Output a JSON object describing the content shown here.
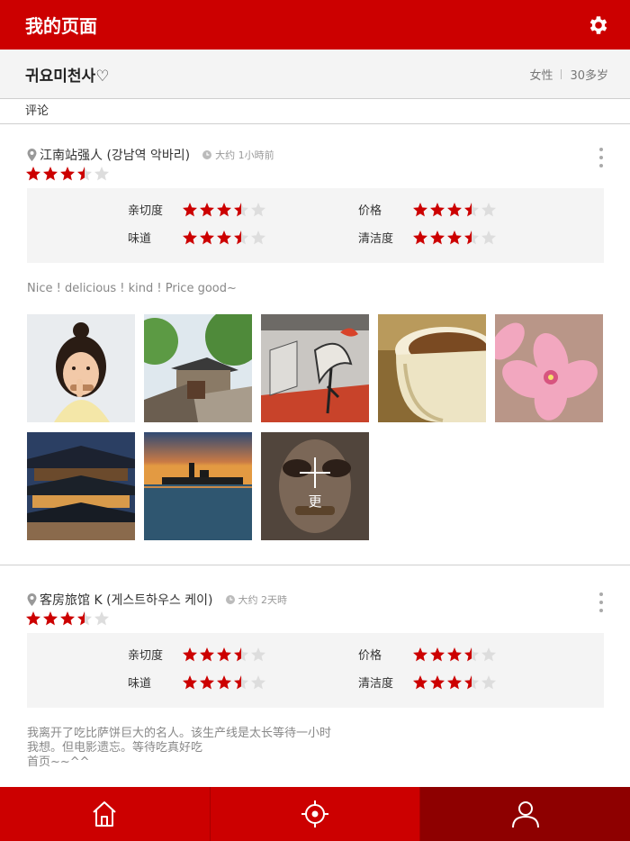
{
  "header": {
    "title": "我的页面",
    "settings_icon": "gear-icon"
  },
  "profile": {
    "name": "귀요미천사♡",
    "gender": "女性",
    "age": "30多岁"
  },
  "section_tab": "评论",
  "rating_labels": {
    "kindness": "亲切度",
    "price": "价格",
    "taste": "味道",
    "cleanliness": "清洁度"
  },
  "reviews": [
    {
      "place": "江南站强人 (강남역 악바리)",
      "time": "大约 1小時前",
      "overall": 3.5,
      "ratings": {
        "kindness": 3.5,
        "price": 3.5,
        "taste": 3.5,
        "cleanliness": 3.5
      },
      "text": "Nice ! delicious ! kind ! Price good~",
      "photos": [
        "girl-portrait",
        "hanok-alley",
        "mural-wall",
        "coffee-cup",
        "pink-flower",
        "palace-night",
        "city-sunset"
      ],
      "more_label": "更"
    },
    {
      "place": "客房旅馆 K (게스트하우스 케이)",
      "time": "大约 2天時",
      "overall": 3.5,
      "ratings": {
        "kindness": 3.5,
        "price": 3.5,
        "taste": 3.5,
        "cleanliness": 3.5
      },
      "text_lines": [
        "我离开了吃比萨饼巨大的名人。该生产线是太长等待一小时",
        "我想。但电影遗忘。等待吃真好吃",
        "首页~~^^"
      ]
    }
  ],
  "bottom_nav": [
    {
      "icon": "home-icon",
      "active": false
    },
    {
      "icon": "location-target-icon",
      "active": false
    },
    {
      "icon": "user-icon",
      "active": true
    }
  ],
  "colors": {
    "brand": "#cc0000",
    "star_filled": "#cc0000",
    "star_empty": "#dddddd",
    "nav_active": "#8e0000"
  }
}
